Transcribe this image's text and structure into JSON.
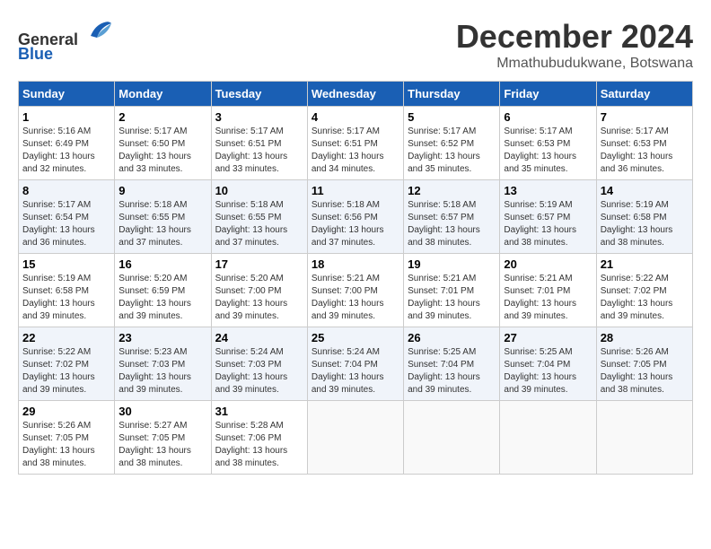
{
  "header": {
    "logo_line1": "General",
    "logo_line2": "Blue",
    "month_title": "December 2024",
    "location": "Mmathubudukwane, Botswana"
  },
  "weekdays": [
    "Sunday",
    "Monday",
    "Tuesday",
    "Wednesday",
    "Thursday",
    "Friday",
    "Saturday"
  ],
  "weeks": [
    [
      {
        "day": "1",
        "sunrise": "5:16 AM",
        "sunset": "6:49 PM",
        "daylight": "13 hours and 32 minutes."
      },
      {
        "day": "2",
        "sunrise": "5:17 AM",
        "sunset": "6:50 PM",
        "daylight": "13 hours and 33 minutes."
      },
      {
        "day": "3",
        "sunrise": "5:17 AM",
        "sunset": "6:51 PM",
        "daylight": "13 hours and 33 minutes."
      },
      {
        "day": "4",
        "sunrise": "5:17 AM",
        "sunset": "6:51 PM",
        "daylight": "13 hours and 34 minutes."
      },
      {
        "day": "5",
        "sunrise": "5:17 AM",
        "sunset": "6:52 PM",
        "daylight": "13 hours and 35 minutes."
      },
      {
        "day": "6",
        "sunrise": "5:17 AM",
        "sunset": "6:53 PM",
        "daylight": "13 hours and 35 minutes."
      },
      {
        "day": "7",
        "sunrise": "5:17 AM",
        "sunset": "6:53 PM",
        "daylight": "13 hours and 36 minutes."
      }
    ],
    [
      {
        "day": "8",
        "sunrise": "5:17 AM",
        "sunset": "6:54 PM",
        "daylight": "13 hours and 36 minutes."
      },
      {
        "day": "9",
        "sunrise": "5:18 AM",
        "sunset": "6:55 PM",
        "daylight": "13 hours and 37 minutes."
      },
      {
        "day": "10",
        "sunrise": "5:18 AM",
        "sunset": "6:55 PM",
        "daylight": "13 hours and 37 minutes."
      },
      {
        "day": "11",
        "sunrise": "5:18 AM",
        "sunset": "6:56 PM",
        "daylight": "13 hours and 37 minutes."
      },
      {
        "day": "12",
        "sunrise": "5:18 AM",
        "sunset": "6:57 PM",
        "daylight": "13 hours and 38 minutes."
      },
      {
        "day": "13",
        "sunrise": "5:19 AM",
        "sunset": "6:57 PM",
        "daylight": "13 hours and 38 minutes."
      },
      {
        "day": "14",
        "sunrise": "5:19 AM",
        "sunset": "6:58 PM",
        "daylight": "13 hours and 38 minutes."
      }
    ],
    [
      {
        "day": "15",
        "sunrise": "5:19 AM",
        "sunset": "6:58 PM",
        "daylight": "13 hours and 39 minutes."
      },
      {
        "day": "16",
        "sunrise": "5:20 AM",
        "sunset": "6:59 PM",
        "daylight": "13 hours and 39 minutes."
      },
      {
        "day": "17",
        "sunrise": "5:20 AM",
        "sunset": "7:00 PM",
        "daylight": "13 hours and 39 minutes."
      },
      {
        "day": "18",
        "sunrise": "5:21 AM",
        "sunset": "7:00 PM",
        "daylight": "13 hours and 39 minutes."
      },
      {
        "day": "19",
        "sunrise": "5:21 AM",
        "sunset": "7:01 PM",
        "daylight": "13 hours and 39 minutes."
      },
      {
        "day": "20",
        "sunrise": "5:21 AM",
        "sunset": "7:01 PM",
        "daylight": "13 hours and 39 minutes."
      },
      {
        "day": "21",
        "sunrise": "5:22 AM",
        "sunset": "7:02 PM",
        "daylight": "13 hours and 39 minutes."
      }
    ],
    [
      {
        "day": "22",
        "sunrise": "5:22 AM",
        "sunset": "7:02 PM",
        "daylight": "13 hours and 39 minutes."
      },
      {
        "day": "23",
        "sunrise": "5:23 AM",
        "sunset": "7:03 PM",
        "daylight": "13 hours and 39 minutes."
      },
      {
        "day": "24",
        "sunrise": "5:24 AM",
        "sunset": "7:03 PM",
        "daylight": "13 hours and 39 minutes."
      },
      {
        "day": "25",
        "sunrise": "5:24 AM",
        "sunset": "7:04 PM",
        "daylight": "13 hours and 39 minutes."
      },
      {
        "day": "26",
        "sunrise": "5:25 AM",
        "sunset": "7:04 PM",
        "daylight": "13 hours and 39 minutes."
      },
      {
        "day": "27",
        "sunrise": "5:25 AM",
        "sunset": "7:04 PM",
        "daylight": "13 hours and 39 minutes."
      },
      {
        "day": "28",
        "sunrise": "5:26 AM",
        "sunset": "7:05 PM",
        "daylight": "13 hours and 38 minutes."
      }
    ],
    [
      {
        "day": "29",
        "sunrise": "5:26 AM",
        "sunset": "7:05 PM",
        "daylight": "13 hours and 38 minutes."
      },
      {
        "day": "30",
        "sunrise": "5:27 AM",
        "sunset": "7:05 PM",
        "daylight": "13 hours and 38 minutes."
      },
      {
        "day": "31",
        "sunrise": "5:28 AM",
        "sunset": "7:06 PM",
        "daylight": "13 hours and 38 minutes."
      },
      null,
      null,
      null,
      null
    ]
  ]
}
